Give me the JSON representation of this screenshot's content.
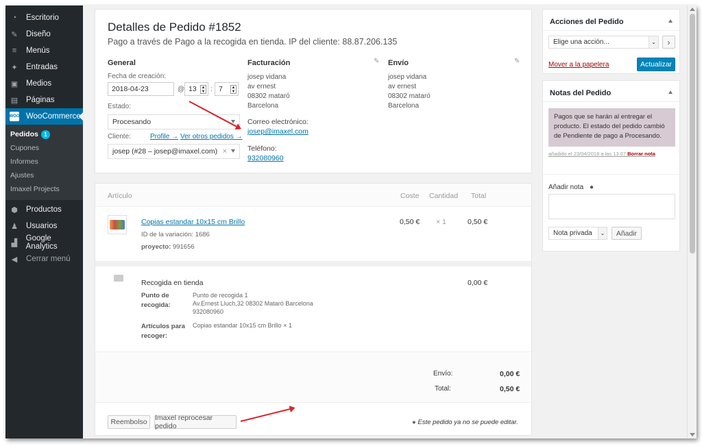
{
  "sidebar": {
    "items": [
      {
        "label": "Escritorio",
        "icon": "dashboard-icon"
      },
      {
        "label": "Diseño",
        "icon": "brush-icon"
      },
      {
        "label": "Menús",
        "icon": "menu-icon"
      },
      {
        "label": "Entradas",
        "icon": "pin-icon"
      },
      {
        "label": "Medios",
        "icon": "media-icon"
      },
      {
        "label": "Páginas",
        "icon": "page-icon"
      },
      {
        "label": "WooCommerce",
        "icon": "woo-icon"
      }
    ],
    "woo_badge": "WOO",
    "submenu": [
      {
        "label": "Pedidos",
        "badge": "1"
      },
      {
        "label": "Cupones"
      },
      {
        "label": "Informes"
      },
      {
        "label": "Ajustes"
      },
      {
        "label": "Imaxel Projects"
      }
    ],
    "items_after": [
      {
        "label": "Productos",
        "icon": "cube-icon"
      },
      {
        "label": "Usuarios",
        "icon": "users-icon"
      },
      {
        "label": "Google Analytics",
        "icon": "chart-icon"
      },
      {
        "label": "Cerrar menú",
        "icon": "collapse-icon"
      }
    ]
  },
  "order": {
    "title": "Detalles de Pedido #1852",
    "subtitle": "Pago a través de Pago a la recogida en tienda. IP del cliente: 88.87.206.135",
    "general": {
      "heading": "General",
      "date_label": "Fecha de creación:",
      "date": "2018-04-23",
      "at": "@",
      "hour": "13",
      "colon": ":",
      "minute": "7",
      "status_label": "Estado:",
      "status": "Procesando",
      "customer_label": "Cliente:",
      "profile_link": "Profile →",
      "other_orders_link": "Ver otros pedidos →",
      "customer": "josep (#28 – josep@imaxel.com)",
      "clear": "×"
    },
    "billing": {
      "heading": "Facturación",
      "lines": [
        "josep vidana",
        "av ernest",
        "08302 mataró",
        "Barcelona"
      ],
      "email_label": "Correo electrónico:",
      "email": "josep@imaxel.com",
      "phone_label": "Teléfono:",
      "phone": "932080960"
    },
    "shipping": {
      "heading": "Envío",
      "lines": [
        "josep vidana",
        "av ernest",
        "08302 mataró",
        "Barcelona"
      ]
    }
  },
  "items": {
    "headers": {
      "item": "Artículo",
      "cost": "Coste",
      "qty": "Cantidad",
      "total": "Total"
    },
    "product": {
      "name": "Copias estandar 10x15 cm Brillo",
      "variation": "ID de la variación: 1686",
      "project_label": "proyecto:",
      "project": "991656",
      "cost": "0,50 €",
      "qty": "× 1",
      "total": "0,50 €"
    },
    "shipping": {
      "method": "Recogida en tienda",
      "total": "0,00 €",
      "point_label": "Punto de recogida:",
      "point_lines": [
        "Punto de recogida 1",
        "Av.Ernest Lluch,32 08302 Mataró Barcelona",
        "932080960"
      ],
      "articles_label": "Artículos para recoger:",
      "articles": "Copias estandar 10x15 cm Brillo × 1"
    },
    "totals": {
      "shipping_label": "Envío:",
      "shipping": "0,00 €",
      "total_label": "Total:",
      "total": "0,50 €"
    },
    "buttons": {
      "refund": "Reembolso",
      "reprocess": "Imaxel reprocesar pedido"
    },
    "not_editable": "Este pedido ya no se puede editar."
  },
  "actions": {
    "heading": "Acciones del Pedido",
    "select": "Elige una acción...",
    "go": "›",
    "trash": "Mover a la papelera",
    "update": "Actualizar"
  },
  "notes": {
    "heading": "Notas del Pedido",
    "note_text": "Pagos que se harán al entregar el producto. El estado del pedido cambió de Pendiente de pago a Procesando.",
    "note_meta": "añadido el 23/04/2018 a las 13:07",
    "delete": "Borrar nota",
    "add_label": "Añadir nota",
    "note_type": "Nota privada",
    "add_button": "Añadir"
  },
  "colors": {
    "accent": "#0073aa",
    "sidebar": "#23282d",
    "note_bg": "#d7cad2",
    "arrow": "#d9232c",
    "danger": "#a00"
  }
}
